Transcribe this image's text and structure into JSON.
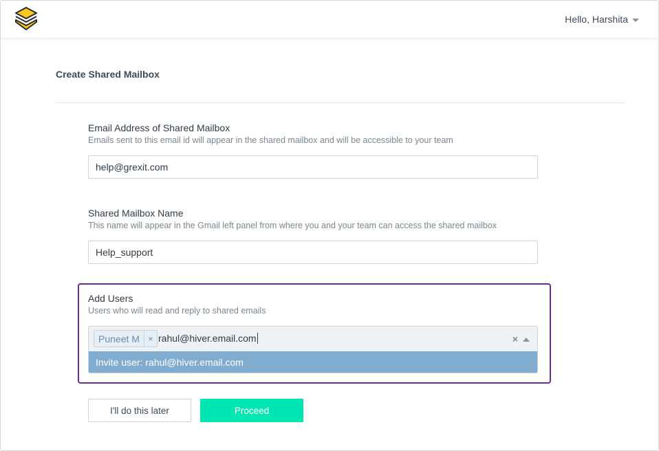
{
  "header": {
    "greeting": "Hello, Harshita"
  },
  "page": {
    "title": "Create Shared Mailbox"
  },
  "email_section": {
    "label": "Email Address of Shared Mailbox",
    "help": "Emails sent to this email id will appear in the shared mailbox and will be accessible to your team",
    "value": "help@grexit.com"
  },
  "name_section": {
    "label": "Shared Mailbox Name",
    "help": "This name will appear in the Gmail left panel from where you and your team can access the shared mailbox",
    "value": "Help_support"
  },
  "users_section": {
    "label": "Add Users",
    "help": "Users who will read and reply to shared emails",
    "chips": [
      {
        "label": "Puneet M",
        "remove": "×"
      }
    ],
    "typed_value": "rahul@hiver.email.com",
    "clear_symbol": "×",
    "dropdown_option": "Invite user: rahul@hiver.email.com"
  },
  "actions": {
    "later_label": "I'll do this later",
    "proceed_label": "Proceed"
  },
  "colors": {
    "accent_border": "#6b2c8f",
    "proceed": "#00e6b3",
    "option_highlight": "#80acd0",
    "logo_yellow": "#f7c91c"
  },
  "icons": {
    "logo": "hiver-logo-icon",
    "user_menu": "caret-down-icon",
    "clear": "clear-icon",
    "toggle": "chevron-up-icon"
  }
}
